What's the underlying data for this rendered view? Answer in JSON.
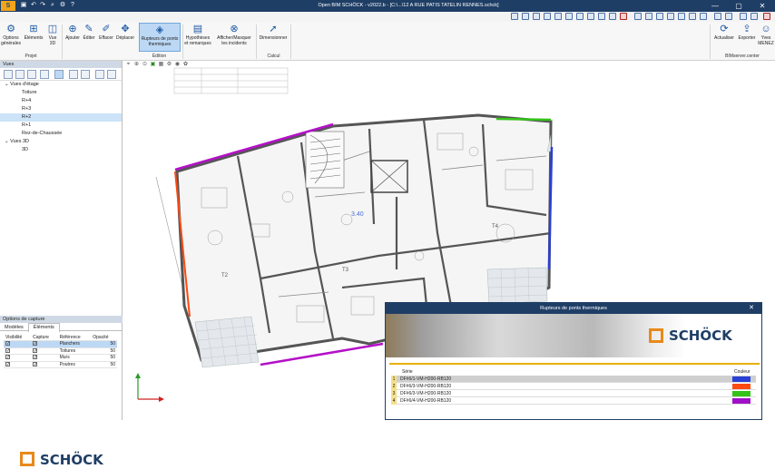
{
  "titlebar": {
    "app_icon": "S",
    "title": "Open BIM SCHÖCK - v2022.b - [C:\\...\\12 A RUE PATIS TATELIN RENNES.schck]",
    "buttons": [
      "—",
      "▢",
      "✕"
    ]
  },
  "ribbon": {
    "buttons": {
      "options": "Options générales",
      "elements": "Éléments",
      "vue3d": "Vue 3D",
      "ajouter": "Ajouter",
      "editer": "Éditer",
      "effacer": "Effacer",
      "deplacer": "Déplacer",
      "rupteurs": "Rupteurs de ponts thermiques",
      "hypotheses": "Hypothèses et remarques",
      "afficher": "Afficher/Masquer les incidents",
      "dimensionner": "Dimensionner",
      "actualiser": "Actualiser",
      "exporter": "Exporter",
      "yves": "Yves MENEZ"
    },
    "groups": {
      "projet": "Projet",
      "edition": "Édition",
      "calcul": "Calcul",
      "bimserver": "BIMserver.center"
    }
  },
  "views": {
    "header": "Vues",
    "tree": [
      {
        "label": "Vues d'étage",
        "indent": 0
      },
      {
        "label": "Toiture",
        "indent": 1
      },
      {
        "label": "R+4",
        "indent": 1
      },
      {
        "label": "R+3",
        "indent": 1
      },
      {
        "label": "R+2",
        "indent": 1,
        "selected": true
      },
      {
        "label": "R+1",
        "indent": 1
      },
      {
        "label": "Rez-de-Chaussée",
        "indent": 1
      },
      {
        "label": "Vues 3D",
        "indent": 0
      },
      {
        "label": "3D",
        "indent": 1
      }
    ]
  },
  "capture": {
    "header": "Options de capture",
    "tabs": [
      "Modèles",
      "Éléments"
    ],
    "columns": [
      "Visibilité",
      "Capture",
      "Référence",
      "Opacité"
    ],
    "rows": [
      {
        "ref": "Planchers",
        "opacity": "50",
        "selected": true
      },
      {
        "ref": "Toitures",
        "opacity": "50"
      },
      {
        "ref": "Murs",
        "opacity": "50"
      },
      {
        "ref": "Poutres",
        "opacity": "50"
      }
    ]
  },
  "branding": {
    "logo_text": "SCHÖCK"
  },
  "plan": {
    "labels": [
      "T2",
      "T4",
      "T3",
      "3.40"
    ]
  },
  "dialog": {
    "title": "Rupteurs de ponts thermiques",
    "close": "✕",
    "logo_text": "SCHÖCK",
    "col_series": "Série",
    "col_color": "Couleur",
    "rows": [
      {
        "num": "1",
        "name": "DF#6/1-VM-H200-RB120",
        "color": "#2a3fd6"
      },
      {
        "num": "2",
        "name": "DF#6/3-VM-H200-RB120",
        "color": "#ff4a10"
      },
      {
        "num": "3",
        "name": "DF#6/3-VM-H200-RB120",
        "color": "#35c21a"
      },
      {
        "num": "4",
        "name": "DF#6/4-VM-H200-RB120",
        "color": "#a010c8"
      }
    ]
  },
  "colors": {
    "titlebar": "#1f3e66",
    "accent": "#e8891b",
    "selection": "#bcd8f5"
  }
}
